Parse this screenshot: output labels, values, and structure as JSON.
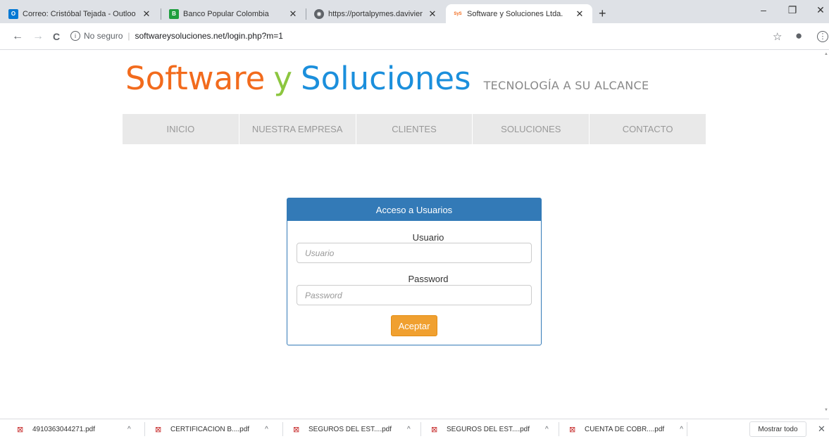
{
  "browser": {
    "tabs": [
      {
        "title": "Correo: Cristóbal Tejada - Outloo",
        "close": "✕",
        "icon": "outlook-icon",
        "color": "#0078d4",
        "glyph": "O"
      },
      {
        "title": "Banco Popular Colombia",
        "close": "✕",
        "icon": "banco-popular-icon",
        "color": "#1e9e3e",
        "glyph": "B"
      },
      {
        "title": "https://portalpymes.davivienda.c",
        "close": "✕",
        "icon": "globe-icon",
        "color": "#5f6368",
        "glyph": "◉"
      },
      {
        "title": "Software y Soluciones Ltda.",
        "close": "✕",
        "icon": "sys-icon",
        "color": "#f26b1d",
        "glyph": "SyS"
      }
    ],
    "new_tab": "+",
    "window": {
      "minimize": "–",
      "maximize": "❐",
      "close": "✕"
    },
    "nav": {
      "back": "←",
      "forward": "→",
      "reload": "C"
    },
    "address": {
      "security": "No seguro",
      "info_glyph": "i",
      "url": "softwareysoluciones.net/login.php?m=1"
    },
    "bookmark": "☆",
    "profile": "●",
    "menu": "⋮"
  },
  "site": {
    "logo": {
      "part1": "Software",
      "part2": "y",
      "part3": "Soluciones",
      "tagline": "TECNOLOGÍA A SU ALCANCE"
    },
    "menu": [
      "INICIO",
      "NUESTRA EMPRESA",
      "CLIENTES",
      "SOLUCIONES",
      "CONTACTO"
    ]
  },
  "login": {
    "heading": "Acceso a Usuarios",
    "user_label": "Usuario",
    "user_placeholder": "Usuario",
    "password_label": "Password",
    "password_placeholder": "Password",
    "submit": "Aceptar"
  },
  "downloads": {
    "items": [
      "4910363044271.pdf",
      "CERTIFICACION B....pdf",
      "SEGUROS DEL EST....pdf",
      "SEGUROS DEL EST....pdf",
      "CUENTA DE COBR....pdf"
    ],
    "caret": "^",
    "show_all": "Mostrar todo",
    "close": "✕"
  },
  "colors": {
    "orange": "#f26b1d",
    "green": "#8cc63f",
    "blue": "#1b8fdc",
    "panel": "#337ab7",
    "button": "#f0a030"
  }
}
